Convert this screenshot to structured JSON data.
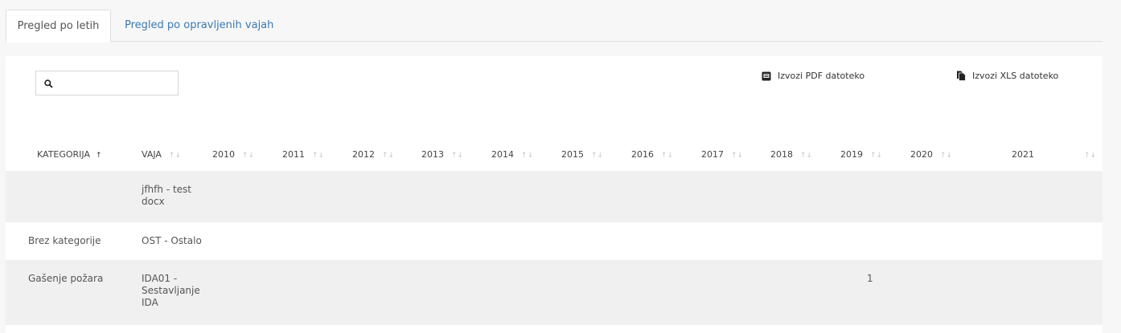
{
  "tabs": [
    {
      "label": "Pregled po letih",
      "active": true
    },
    {
      "label": "Pregled po opravljenih vajah",
      "active": false
    }
  ],
  "search": {
    "placeholder": "",
    "icon": "search-icon"
  },
  "exports": {
    "pdf_label": "Izvozi PDF datoteko",
    "xls_label": "Izvozi XLS datoteko"
  },
  "table": {
    "headers": {
      "kategorija": "KATEGORIJA",
      "vaja": "VAJA",
      "years": [
        "2010",
        "2011",
        "2012",
        "2013",
        "2014",
        "2015",
        "2016",
        "2017",
        "2018",
        "2019",
        "2020",
        "2021"
      ]
    },
    "sort_icons": {
      "active": "↑",
      "inactive": "↑↓"
    },
    "rows": [
      {
        "kategorija": "",
        "vaja_lines": [
          "jfhfh - test",
          "docx"
        ],
        "y2019": ""
      },
      {
        "kategorija": "Brez kategorije",
        "vaja_lines": [
          "OST - Ostalo"
        ],
        "y2019": ""
      },
      {
        "kategorija": "Gašenje požara",
        "vaja_lines": [
          "IDA01 -",
          "Sestavljanje",
          "IDA"
        ],
        "y2019": "1"
      }
    ]
  },
  "colors": {
    "link": "#3a79b0",
    "stripe": "#f0f0f0",
    "border": "#dedede"
  }
}
